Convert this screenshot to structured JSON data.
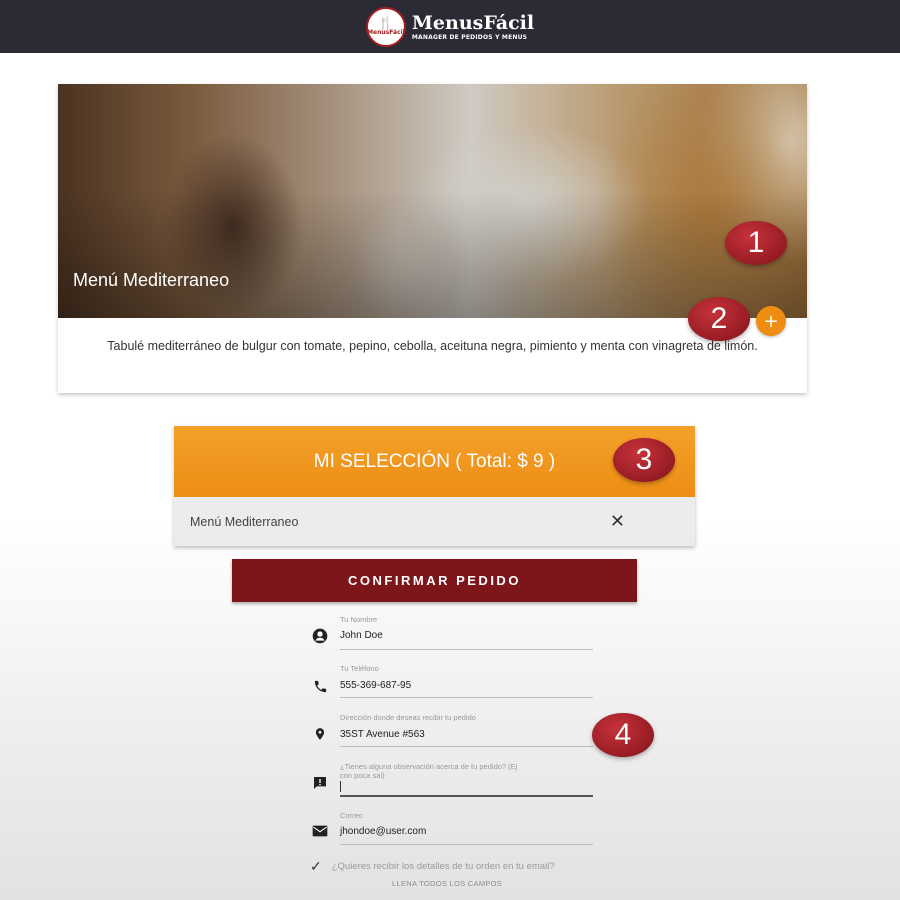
{
  "header": {
    "brand": "MenusFácil",
    "tagline": "MANAGER DE PEDIDOS Y MENUS",
    "badge_text": "MenusFácil",
    "bg_color": "#2b2a35"
  },
  "card": {
    "title": "Menú Mediterraneo",
    "description": "Tabulé mediterráneo de bulgur con tomate, pepino, cebolla, aceituna negra, pimiento y menta con vinagreta de limón.",
    "add_label": "+",
    "accent_color": "#ef8c12"
  },
  "markers": [
    "1",
    "2",
    "3",
    "4"
  ],
  "selection": {
    "title": "MI SELECCIÓN ( Total: $ 9 )",
    "items": [
      {
        "name": "Menú Mediterraneo",
        "remove_icon": "close-icon"
      }
    ]
  },
  "confirm": {
    "label": "CONFIRMAR PEDIDO",
    "color": "#7c161b"
  },
  "form": {
    "name": {
      "label": "Tu Nombre",
      "value": "John Doe",
      "icon": "person-icon"
    },
    "phone": {
      "label": "Tu Teléfono",
      "value": "555-369-687-95",
      "icon": "phone-icon"
    },
    "address": {
      "label": "Dirección donde deseas recibir tu pedido",
      "value": "35ST Avenue #563",
      "icon": "location-pin-icon"
    },
    "notes": {
      "label_line1": "¿Tienes alguna observación acerca de tu pedido? (Ej",
      "label_line2": "con poca sal)",
      "value": "",
      "icon": "feedback-icon"
    },
    "email": {
      "label": "Correo",
      "value": "jhondoe@user.com",
      "icon": "mail-icon"
    },
    "receive_email": {
      "label": "¿Quieres recibir los detalles de tu orden en tu email?",
      "icon": "check-icon"
    },
    "footer_note": "LLENA TODOS LOS CAMPOS"
  }
}
